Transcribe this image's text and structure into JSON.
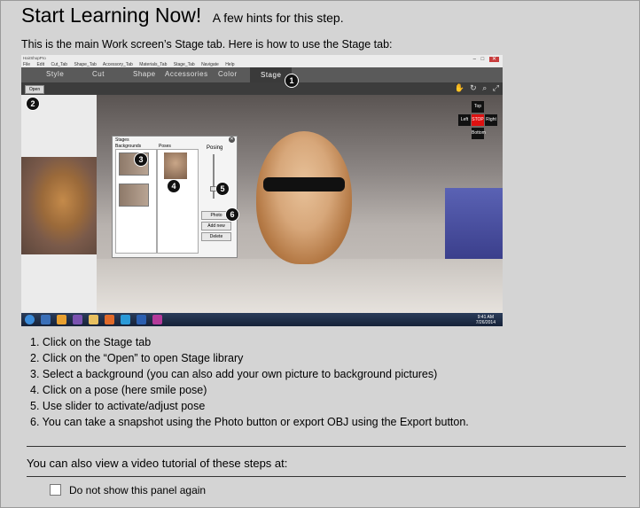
{
  "header": {
    "title": "Start Learning Now!",
    "subtitle": "A few hints for this step."
  },
  "intro": "This is the main Work screen’s Stage tab. Here is how to use the Stage tab:",
  "screenshot": {
    "app_name": "HairShopPro",
    "menu": [
      "File",
      "Edit",
      "Cut_Tab",
      "Shape_Tab",
      "Accessory_Tab",
      "Materials_Tab",
      "Stage_Tab",
      "Navigate",
      "Help"
    ],
    "tabs": [
      "Style",
      "Cut",
      "Shape",
      "Accessories",
      "Color",
      "Stage"
    ],
    "active_tab": "Stage",
    "open_button": "Open",
    "dialog": {
      "title": "Stages",
      "backgrounds_header": "Backgrounds",
      "poses_header": "Poses",
      "posing_label": "Posing",
      "buttons": [
        "Photo",
        "Add new",
        "Delete"
      ]
    },
    "nav": {
      "top": "Top",
      "left": "Left",
      "stop": "STOP",
      "right": "Right",
      "bottom": "Bottom"
    },
    "clock": {
      "time": "9:41 AM",
      "date": "7/26/2014"
    },
    "markers": [
      "1",
      "2",
      "3",
      "4",
      "5",
      "6"
    ]
  },
  "steps": [
    "1. Click on the Stage tab",
    "2. Click on the “Open” to open Stage library",
    "3. Select a background (you can also add your own picture to background pictures)",
    "4. Click on a pose (here smile pose)",
    "5. Use slider to activate/adjust pose",
    "6. You can take a snapshot using the Photo button or export OBJ using the Export button."
  ],
  "video_text": "You can also view a video tutorial of these steps at:",
  "checkbox": {
    "label": "Do not show this panel again",
    "checked": false
  }
}
